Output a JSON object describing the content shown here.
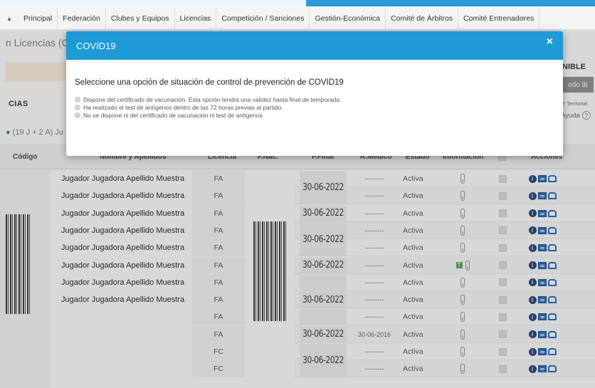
{
  "nav": {
    "home_arrow": "▴",
    "items": [
      "Principal",
      "Federación",
      "Clubes y Equipos",
      "Licencias",
      "Competición / Sanciones",
      "Gestión-Económica",
      "Comité de Árbitros",
      "Comité Entrenadores"
    ]
  },
  "page": {
    "heading": "n Licencias (C",
    "section_title": "CIAS",
    "count_text": "(19 J + 2 A) Ju",
    "right_label": "NIBLE",
    "right_button": "odo ⊞",
    "right_territorial": "F Territorial",
    "right_help": "Ayuda",
    "help_mark": "?"
  },
  "table": {
    "columns": [
      "Código",
      "Nombre y Apellidos",
      "Licencia",
      "F.Nac.",
      "F.Final",
      "R.Médico",
      "Estado",
      "Información",
      "",
      "Acciones"
    ],
    "rows": [
      {
        "name": "Jugador Jugadora Apellido Muestra",
        "licencia": "FA",
        "medico": "---------",
        "estado": "Activa",
        "green": false
      },
      {
        "name": "Jugador Jugadora Apellido Muestra",
        "licencia": "FA",
        "medico": "---------",
        "estado": "Activa",
        "green": false
      },
      {
        "name": "Jugador Jugadora Apellido Muestra",
        "licencia": "FA",
        "medico": "---------",
        "estado": "Activa",
        "green": false
      },
      {
        "name": "Jugador Jugadora Apellido Muestra",
        "licencia": "FA",
        "medico": "---------",
        "estado": "Activa",
        "green": false
      },
      {
        "name": "Jugador Jugadora Apellido Muestra",
        "licencia": "FA",
        "medico": "---------",
        "estado": "Activa",
        "green": false
      },
      {
        "name": "Jugador Jugadora Apellido Muestra",
        "licencia": "FA",
        "medico": "---------",
        "estado": "Activa",
        "green": true
      },
      {
        "name": "Jugador Jugadora Apellido Muestra",
        "licencia": "FA",
        "medico": "---------",
        "estado": "Activa",
        "green": false
      },
      {
        "name": "Jugador Jugadora Apellido Muestra",
        "licencia": "FA",
        "medico": "---------",
        "estado": "Activa",
        "green": false
      },
      {
        "name": "",
        "licencia": "FA",
        "medico": "---------",
        "estado": "Activa",
        "green": false
      },
      {
        "name": "",
        "licencia": "FA",
        "medico": "30-06-2016",
        "estado": "Activa",
        "green": false
      },
      {
        "name": "",
        "licencia": "FC",
        "medico": "---------",
        "estado": "Activa",
        "green": false
      },
      {
        "name": "",
        "licencia": "FC",
        "medico": "---------",
        "estado": "Activa",
        "green": false
      }
    ],
    "ffinal_groups": [
      {
        "start": 0,
        "span": 2,
        "date": "30-06-2022"
      },
      {
        "start": 2,
        "span": 1,
        "date": "30-06-2022"
      },
      {
        "start": 3,
        "span": 2,
        "date": "30-06-2022"
      },
      {
        "start": 5,
        "span": 1,
        "date": "30-06-2022"
      },
      {
        "start": 6,
        "span": 1,
        "date": ""
      },
      {
        "start": 7,
        "span": 1,
        "date": "30-06-2022"
      },
      {
        "start": 8,
        "span": 1,
        "date": ""
      },
      {
        "start": 9,
        "span": 1,
        "date": "30-06-2022"
      },
      {
        "start": 10,
        "span": 2,
        "date": "30-06-2022"
      }
    ]
  },
  "modal": {
    "title": "COVID19",
    "close": "×",
    "question": "Seleccione una opción de situación de control de prevención de COVID19",
    "options": [
      "Dispone del certificado de vacunación. Esta opción tendrá una validez hasta final de temporada.",
      "Ha realizado el test de antígenos dentro de las 72 horas previas al partido.",
      "No se dispone ni del certificado de vacunación ni test de antígenos"
    ]
  },
  "colors": {
    "accent": "#1e9ad6",
    "action_icons": "#1e66b7",
    "status_green": "#4caf50"
  }
}
